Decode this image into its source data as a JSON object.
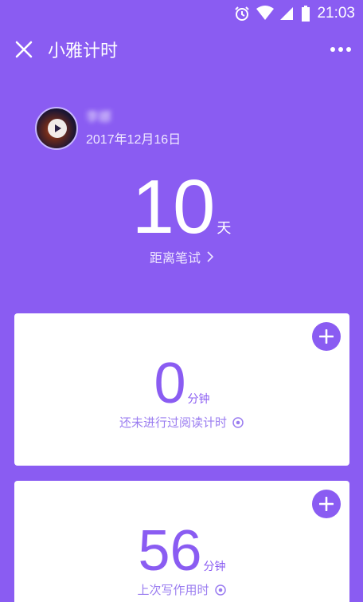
{
  "status_bar": {
    "time": "21:03"
  },
  "app_bar": {
    "title": "小雅计时"
  },
  "profile": {
    "name": "李娜",
    "date": "2017年12月16日"
  },
  "countdown": {
    "value": "10",
    "unit": "天",
    "label": "距离笔试"
  },
  "cards": [
    {
      "value": "0",
      "unit": "分钟",
      "caption": "还未进行过阅读计时"
    },
    {
      "value": "56",
      "unit": "分钟",
      "caption": "上次写作用时"
    }
  ],
  "colors": {
    "accent": "#8a5cf2",
    "card": "#ffffff"
  }
}
